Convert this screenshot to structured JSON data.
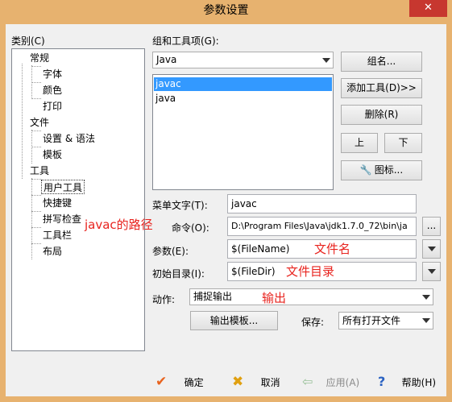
{
  "window": {
    "title": "参数设置",
    "close_glyph": "✕"
  },
  "categories": {
    "label": "类别(C)",
    "items": [
      {
        "label": "常规"
      },
      {
        "label": "字体"
      },
      {
        "label": "颜色"
      },
      {
        "label": "打印"
      },
      {
        "label": "文件"
      },
      {
        "label": "设置 & 语法"
      },
      {
        "label": "模板"
      },
      {
        "label": "工具"
      },
      {
        "label": "用户工具"
      },
      {
        "label": "快捷键"
      },
      {
        "label": "拼写检查"
      },
      {
        "label": "工具栏"
      },
      {
        "label": "布局"
      }
    ]
  },
  "group": {
    "label": "组和工具项(G):",
    "selected": "Java",
    "list": [
      "javac",
      "java"
    ],
    "group_name_button": "组名...",
    "add_tool_button": "添加工具(D)>>",
    "delete_button": "删除(R)",
    "up_button": "上",
    "down_button": "下",
    "icon_button": "图标..."
  },
  "fields": {
    "menu_text_label": "菜单文字(T):",
    "menu_text_value": "javac",
    "command_label": "命令(O):",
    "command_value": "D:\\Program Files\\Java\\jdk1.7.0_72\\bin\\ja",
    "args_label": "参数(E):",
    "args_value": "$(FileName)",
    "initdir_label": "初始目录(I):",
    "initdir_value": "$(FileDir)",
    "browse_button": "...",
    "action_label": "动作:",
    "action_value": "捕捉输出",
    "output_template_button": "输出模板...",
    "save_label": "保存:",
    "save_value": "所有打开文件"
  },
  "annotations": {
    "javac_path": "javac的路径",
    "file_name": "文件名",
    "file_dir": "文件目录",
    "output": "输出"
  },
  "footer": {
    "ok": "确定",
    "cancel": "取消",
    "apply": "应用(A)",
    "help": "帮助(H)"
  },
  "colors": {
    "title_bar": "#e7b26f",
    "selection": "#3399ff",
    "annotation": "#e8231e",
    "close": "#c7372f"
  }
}
